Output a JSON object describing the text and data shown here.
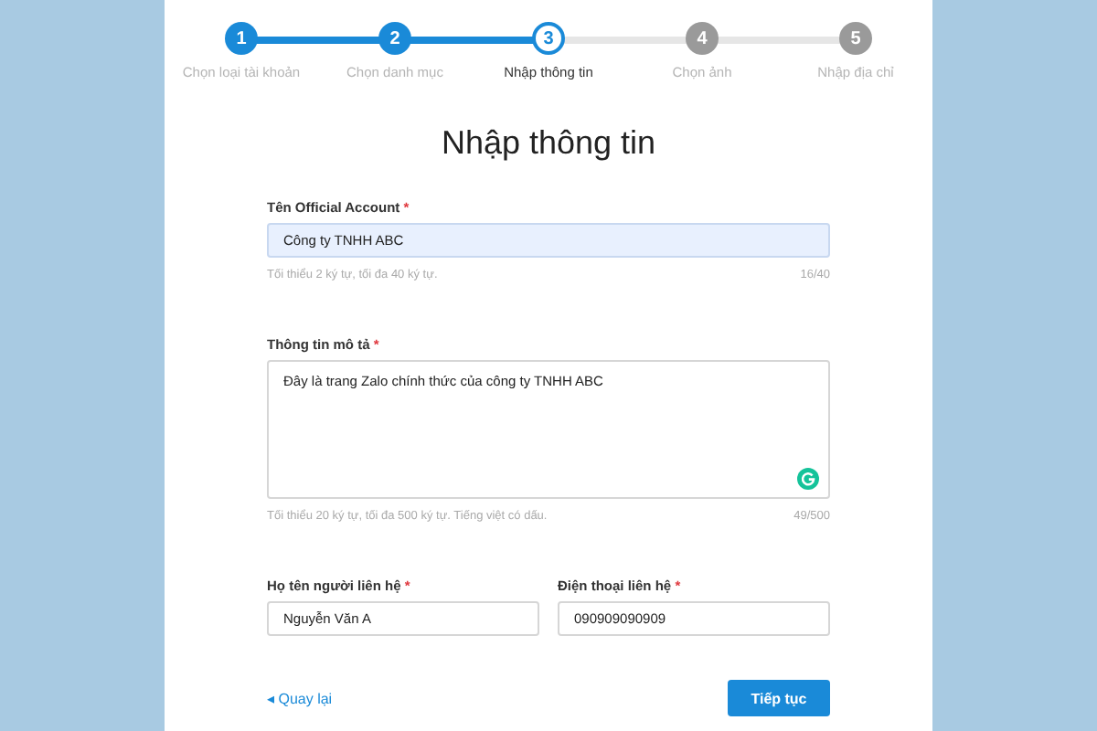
{
  "steps": [
    {
      "number": "1",
      "label": "Chọn loại tài khoản",
      "done": true,
      "selected": false
    },
    {
      "number": "2",
      "label": "Chọn danh mục",
      "done": true,
      "selected": false
    },
    {
      "number": "3",
      "label": "Nhập thông tin",
      "done": false,
      "selected": true
    },
    {
      "number": "4",
      "label": "Chọn ảnh",
      "done": false,
      "selected": false
    },
    {
      "number": "5",
      "label": "Nhập địa chỉ",
      "done": false,
      "selected": false
    }
  ],
  "title": "Nhập thông tin",
  "name_field": {
    "label": "Tên Official Account",
    "required_mark": "*",
    "value": "Công ty TNHH ABC",
    "hint": "Tối thiểu 2 ký tự, tối đa 40 ký tự.",
    "count": "16/40"
  },
  "description_field": {
    "label": "Thông tin mô tả",
    "required_mark": "*",
    "value": "Đây là trang Zalo chính thức của công ty TNHH ABC",
    "hint": "Tối thiểu 20 ký tự, tối đa 500 ký tự. Tiếng việt có dấu.",
    "count": "49/500"
  },
  "contact_fields": [
    {
      "label": "Họ tên người liên hệ",
      "required_mark": "*",
      "value": "Nguyễn Văn A"
    },
    {
      "label": "Điện thoại liên hệ",
      "required_mark": "*",
      "value": "090909090909"
    }
  ],
  "back_link": {
    "arrow": "◂",
    "label": "Quay lại"
  },
  "next_button": "Tiếp tục"
}
